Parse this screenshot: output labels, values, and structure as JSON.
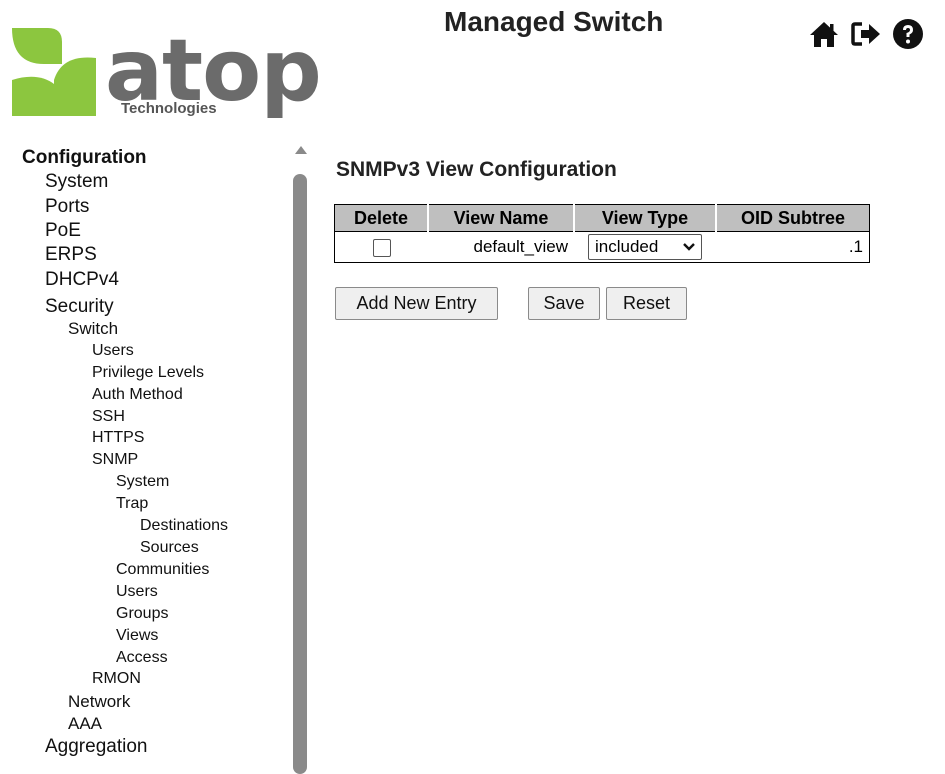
{
  "header": {
    "logo_word": "atop",
    "logo_tagline": "Technologies",
    "title": "Managed Switch",
    "icons": [
      "home-icon",
      "logout-icon",
      "help-icon"
    ]
  },
  "sidebar": {
    "root": "Configuration",
    "items": [
      {
        "label": "System"
      },
      {
        "label": "Ports"
      },
      {
        "label": "PoE"
      },
      {
        "label": "ERPS"
      },
      {
        "label": "DHCPv4"
      },
      {
        "label": "Security"
      },
      {
        "label": "Switch"
      },
      {
        "label": "Users"
      },
      {
        "label": "Privilege Levels"
      },
      {
        "label": "Auth Method"
      },
      {
        "label": "SSH"
      },
      {
        "label": "HTTPS"
      },
      {
        "label": "SNMP"
      },
      {
        "label": "System"
      },
      {
        "label": "Trap"
      },
      {
        "label": "Destinations"
      },
      {
        "label": "Sources"
      },
      {
        "label": "Communities"
      },
      {
        "label": "Users"
      },
      {
        "label": "Groups"
      },
      {
        "label": "Views"
      },
      {
        "label": "Access"
      },
      {
        "label": "RMON"
      },
      {
        "label": "Network"
      },
      {
        "label": "AAA"
      },
      {
        "label": "Aggregation"
      }
    ]
  },
  "main": {
    "title": "SNMPv3 View Configuration",
    "table": {
      "headers": [
        "Delete",
        "View Name",
        "View Type",
        "OID Subtree"
      ],
      "rows": [
        {
          "view_name": "default_view",
          "view_type": "included",
          "oid_subtree": ".1",
          "delete_checked": false
        }
      ]
    },
    "buttons": {
      "add": "Add New Entry",
      "save": "Save",
      "reset": "Reset"
    }
  },
  "colors": {
    "logo_green": "#8cc63f",
    "header_bg": "#bfbfbf",
    "scrollbar": "#8a8a8a"
  }
}
